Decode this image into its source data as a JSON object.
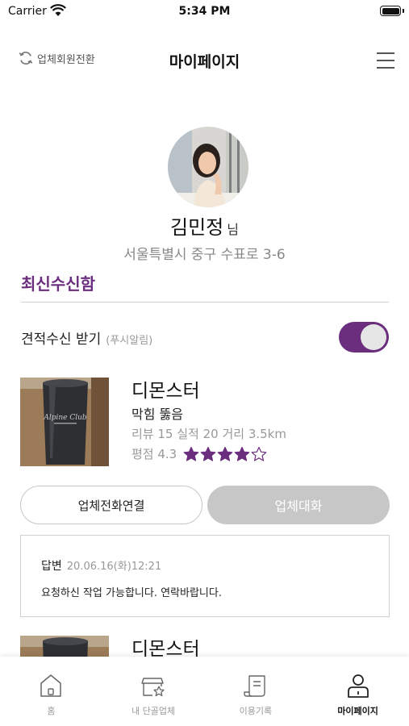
{
  "status_bar": {
    "carrier": "Carrier",
    "time": "5:34 PM"
  },
  "header": {
    "switch_label": "업체회원전환",
    "title": "마이페이지"
  },
  "profile": {
    "name": "김민정",
    "suffix": "님",
    "address": "서울특별시 중구 수표로 3-6"
  },
  "inbox": {
    "title": "최신수신함",
    "toggle_label": "견적수신 받기",
    "toggle_sub": "(푸시알림)",
    "toggle_on": true
  },
  "companies": [
    {
      "name": "디몬스터",
      "service": "막힘 뚫음",
      "stats": "리뷰 15 실적 20 거리 3.5km",
      "rating_text": "평점 4.3",
      "rating": 4.3,
      "stars_filled": 4,
      "stars_total": 5,
      "cup_text": "Alpine Club",
      "call_button": "업체전화연결",
      "chat_button": "업체대화",
      "reply": {
        "label": "답변",
        "date": "20.06.16(화)12:21",
        "message": "요청하신 작업 가능합니다. 연락바랍니다."
      }
    },
    {
      "name": "디몬스터"
    }
  ],
  "tabs": [
    {
      "label": "홈",
      "icon": "home-icon"
    },
    {
      "label": "내 단골업체",
      "icon": "favorite-shop-icon"
    },
    {
      "label": "이용기록",
      "icon": "history-scroll-icon"
    },
    {
      "label": "마이페이지",
      "icon": "person-icon",
      "active": true
    }
  ],
  "colors": {
    "accent": "#6b2d7d",
    "disabled_button": "#c7c7c7",
    "muted_text": "#999999"
  }
}
